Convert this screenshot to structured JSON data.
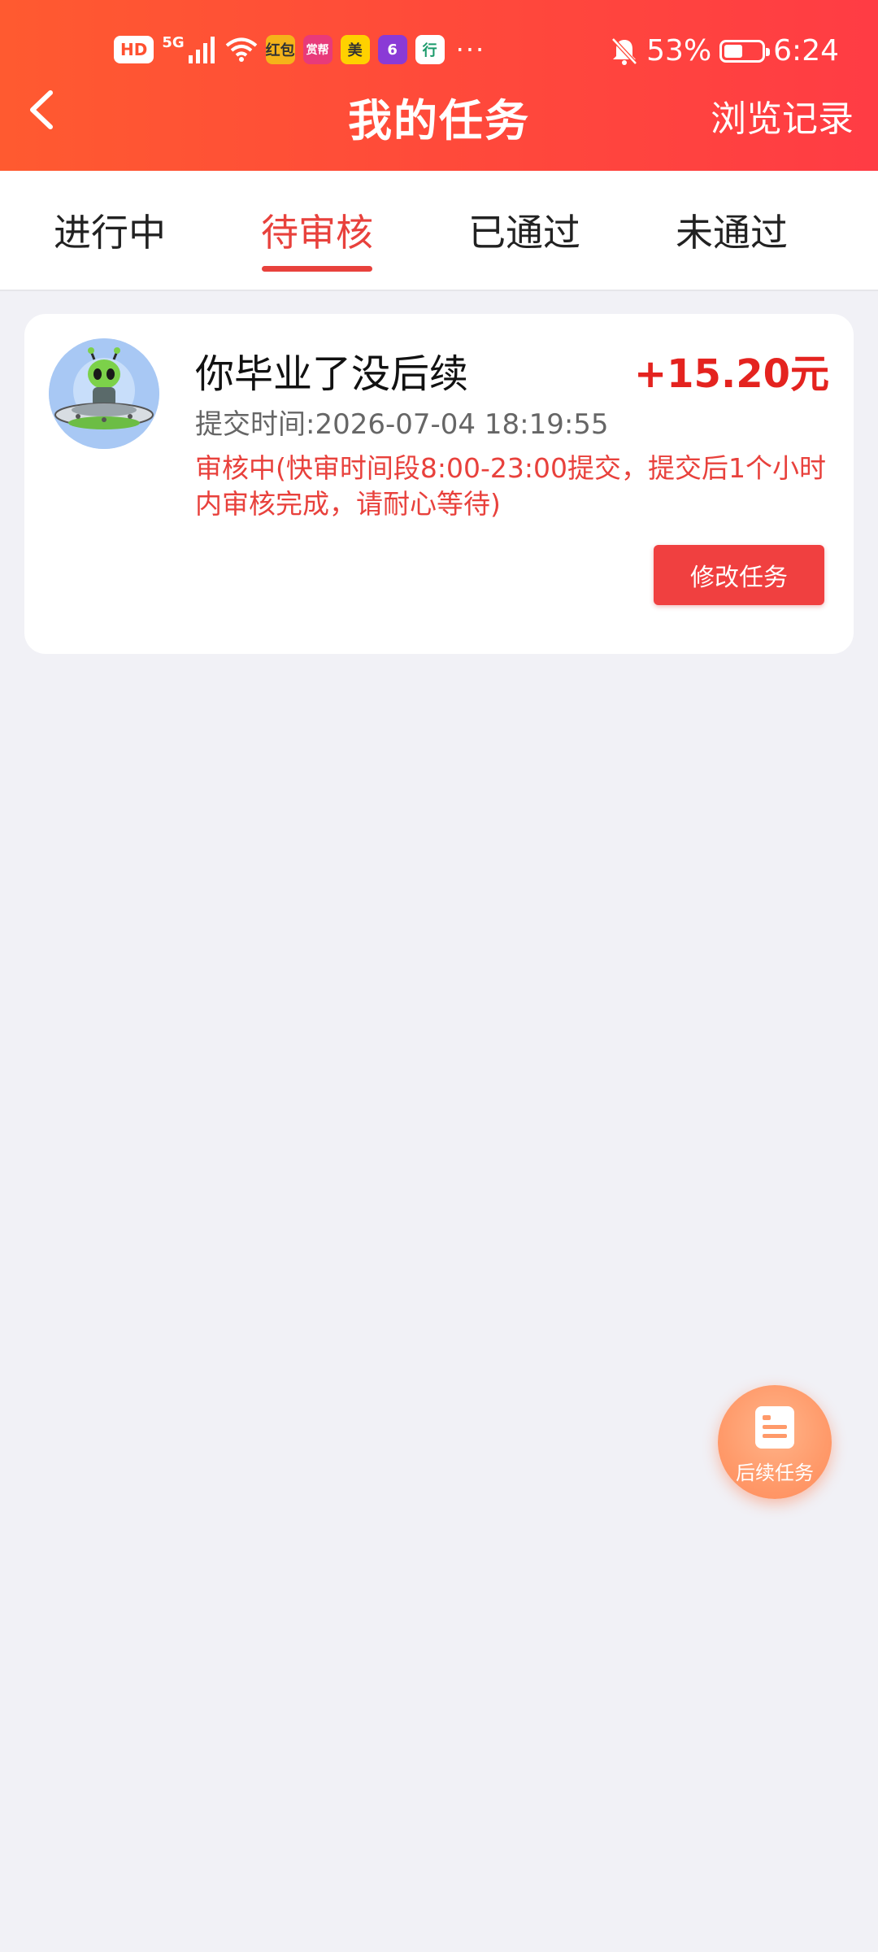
{
  "status_bar": {
    "hd": "HD",
    "network": "5G",
    "app_icons": [
      {
        "name": "app-icon-1",
        "text": "红包",
        "color": "#f5b31a"
      },
      {
        "name": "app-icon-2",
        "text": "赏帮",
        "color": "#e83a7a"
      },
      {
        "name": "app-icon-3",
        "text": "美",
        "color": "#ffd100"
      },
      {
        "name": "app-icon-4",
        "text": "6",
        "color": "#8a3ad6"
      },
      {
        "name": "app-icon-5",
        "text": "行",
        "color": "#1a9a6a"
      }
    ],
    "more": "···",
    "battery": "53%",
    "battery_level": 0.53,
    "time": "6:24"
  },
  "header": {
    "title": "我的任务",
    "right_link": "浏览记录"
  },
  "tabs": [
    {
      "label": "进行中",
      "active": false
    },
    {
      "label": "待审核",
      "active": true
    },
    {
      "label": "已通过",
      "active": false
    },
    {
      "label": "未通过",
      "active": false
    }
  ],
  "task": {
    "title": "你毕业了没后续",
    "reward": "+15.20元",
    "submit_time": "提交时间:2026-07-04 18:19:55",
    "status": "审核中(快审时间段8:00-23:00提交，提交后1个小时内审核完成，请耐心等待)",
    "action": "修改任务"
  },
  "fab": {
    "label": "后续任务"
  },
  "colors": {
    "header_start": "#ff5a30",
    "header_end": "#ff3c44",
    "accent": "#e8413c",
    "reward": "#e4231f"
  }
}
